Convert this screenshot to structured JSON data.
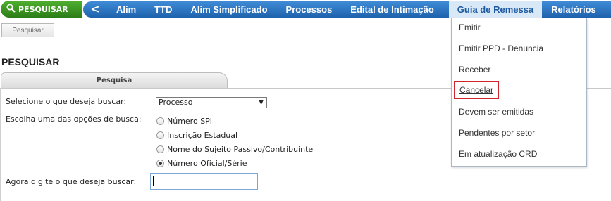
{
  "topbar": {
    "search_button": "PESQUISAR",
    "back_glyph": "<",
    "nav_items": [
      "Alim",
      "TTD",
      "Alim Simplificado",
      "Processos",
      "Edital de Intimação",
      "Guia de Remessa",
      "Relatórios"
    ],
    "active_item": "Guia de Remessa"
  },
  "toolbar": {
    "pesquisar_label": "Pesquisar"
  },
  "page": {
    "title": "PESQUISAR",
    "tab": "Pesquisa"
  },
  "form": {
    "select_label": "Selecione o que deseja buscar:",
    "select_value": "Processo",
    "options_label": "Escolha uma das opções de busca:",
    "options": [
      {
        "label": "Número SPI",
        "checked": false
      },
      {
        "label": "Inscrição Estadual",
        "checked": false
      },
      {
        "label": "Nome do Sujeito Passivo/Contribuinte",
        "checked": false
      },
      {
        "label": "Número Oficial/Série",
        "checked": true
      }
    ],
    "input_label": "Agora digite o que deseja buscar:",
    "input_value": ""
  },
  "dropdown": {
    "items": [
      "Emitir",
      "Emitir PPD - Denuncia",
      "Receber",
      "Cancelar",
      "Devem ser emitidas",
      "Pendentes por setor",
      "Em atualização CRD"
    ],
    "highlighted": "Cancelar"
  },
  "colors": {
    "nav_blue": "#2a72c2",
    "search_green": "#3a9a22",
    "highlight_red": "#d0262b"
  },
  "icons": {
    "search_button_icon": "magnifier-icon",
    "select_arrow": "triangle-down-icon"
  }
}
